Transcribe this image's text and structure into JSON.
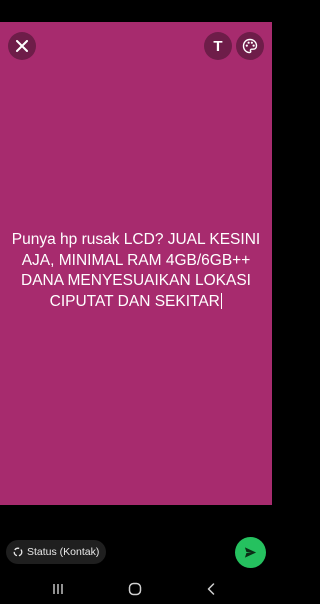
{
  "theme": {
    "background_color": "#a72b6e",
    "accent_color": "#25c15f"
  },
  "toolbar": {
    "close_icon": "close-icon",
    "text_tool_label": "T",
    "palette_icon": "palette-icon"
  },
  "status": {
    "text": "Punya hp rusak LCD? JUAL KESINI AJA, MINIMAL RAM 4GB/6GB++\nDANA MENYESUAIKAN LOKASI CIPUTAT DAN SEKITAR"
  },
  "footer": {
    "audience_label": "Status (Kontak)",
    "audience_icon": "status-ring-icon",
    "send_icon": "send-icon"
  },
  "nav": {
    "recent_icon": "recent-apps-icon",
    "home_icon": "home-icon",
    "back_icon": "back-icon"
  }
}
